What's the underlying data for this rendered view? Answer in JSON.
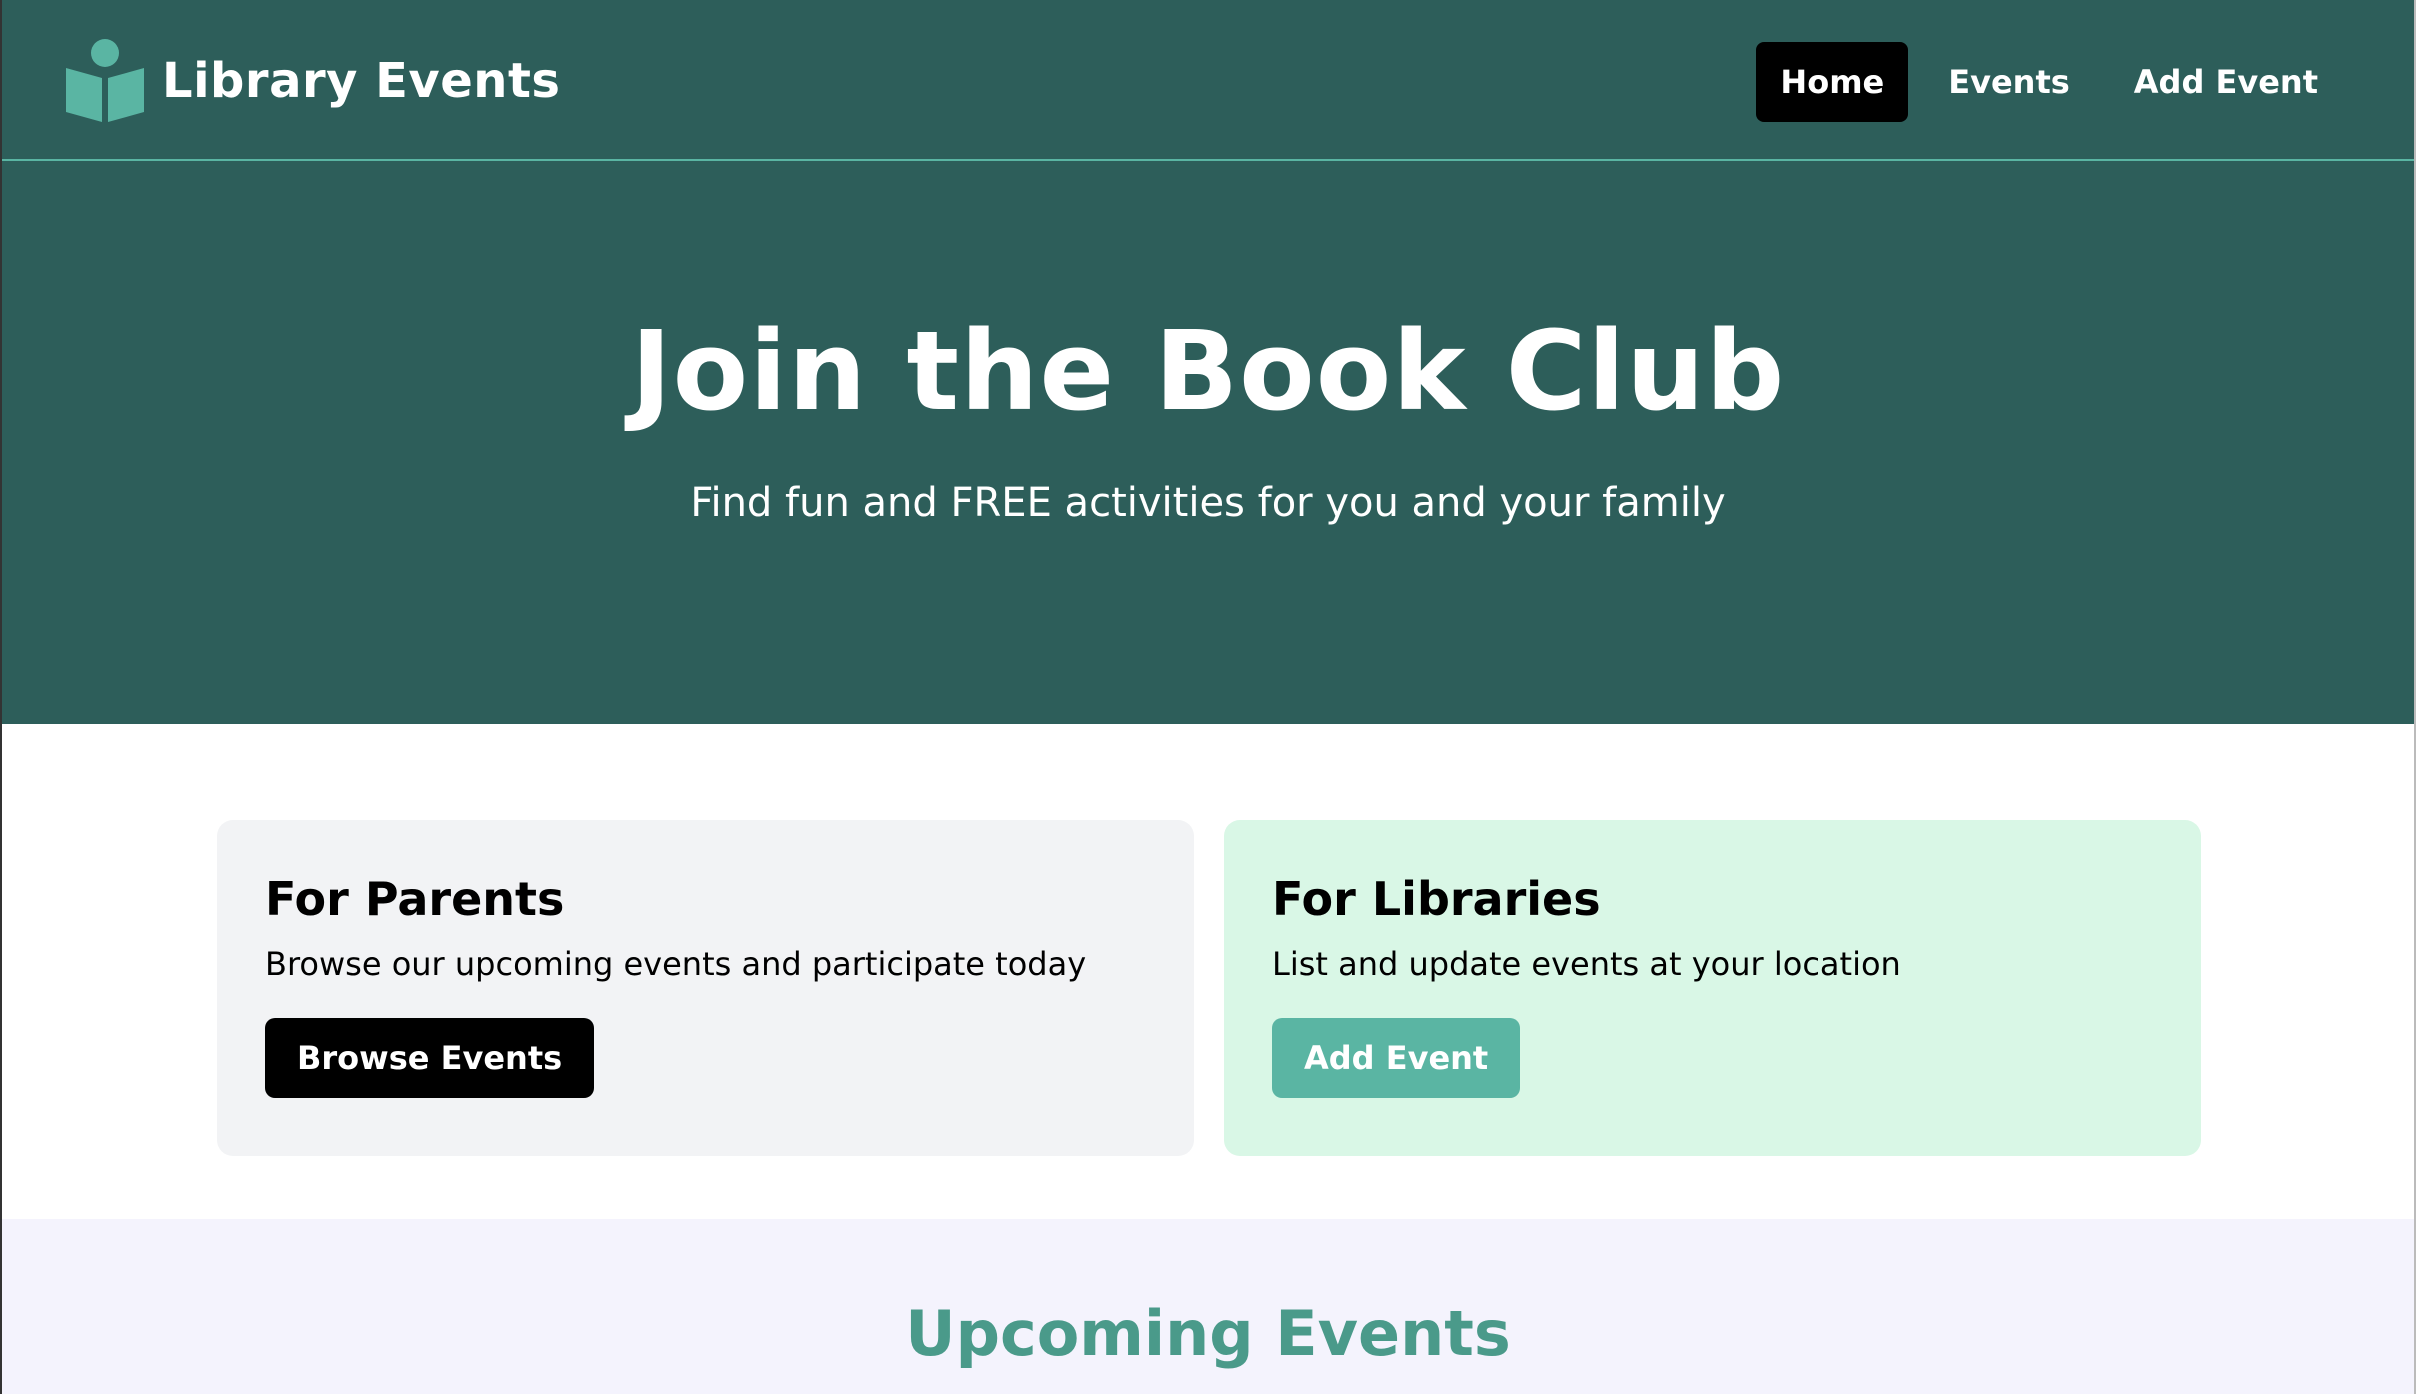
{
  "colors": {
    "primary_dark": "#2d5e5a",
    "accent_teal": "#5ab5a3",
    "heading_teal": "#4a9a8a",
    "parents_card_bg": "#f2f3f5",
    "libraries_card_bg": "#d9f7e6",
    "upcoming_bg": "#f4f3fd",
    "active_nav_bg": "#000000"
  },
  "header": {
    "brand_icon": "reader-book-icon",
    "brand_name": "Library Events",
    "nav": [
      {
        "label": "Home",
        "active": true
      },
      {
        "label": "Events",
        "active": false
      },
      {
        "label": "Add Event",
        "active": false
      }
    ]
  },
  "hero": {
    "title": "Join the Book Club",
    "subtitle": "Find fun and FREE activities for you and your family"
  },
  "cards": {
    "parents": {
      "title": "For Parents",
      "text": "Browse our upcoming events and participate today",
      "button": "Browse Events"
    },
    "libraries": {
      "title": "For Libraries",
      "text": "List and update events at your location",
      "button": "Add Event"
    }
  },
  "upcoming": {
    "title": "Upcoming Events"
  }
}
